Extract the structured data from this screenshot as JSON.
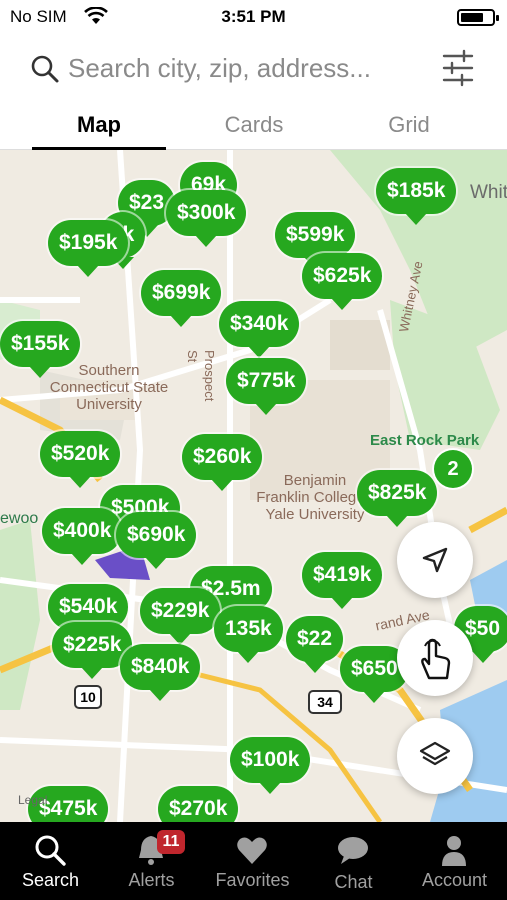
{
  "status_bar": {
    "carrier": "No SIM",
    "time": "3:51 PM"
  },
  "search": {
    "placeholder": "Search city, zip, address..."
  },
  "tabs": [
    {
      "label": "Map",
      "active": true
    },
    {
      "label": "Cards",
      "active": false
    },
    {
      "label": "Grid",
      "active": false
    }
  ],
  "map": {
    "places": {
      "university": "Southern Connecticut State University",
      "college": "Benjamin Franklin College - Yale University",
      "park": "East Rock Park",
      "street_whitney": "Whitney Ave",
      "street_prospect": "Prospect St",
      "street_orand": "rand Ave",
      "whitneyville": "Whitne",
      "westwood": "ewoo",
      "legal": "Legal",
      "route_34": "34",
      "route_10": "10"
    },
    "cluster_count": "2",
    "listings": [
      {
        "price": "$23",
        "color": "#26a81f"
      },
      {
        "price": "69k",
        "color": "#26a81f"
      },
      {
        "price": "0k",
        "color": "#26a81f"
      },
      {
        "price": "$300k",
        "color": "#26a81f"
      },
      {
        "price": "$195k",
        "color": "#26a81f"
      },
      {
        "price": "$599k",
        "color": "#26a81f"
      },
      {
        "price": "$185k",
        "color": "#26a81f"
      },
      {
        "price": "$625k",
        "color": "#26a81f"
      },
      {
        "price": "$699k",
        "color": "#26a81f"
      },
      {
        "price": "$340k",
        "color": "#26a81f"
      },
      {
        "price": "$155k",
        "color": "#26a81f"
      },
      {
        "price": "$775k",
        "color": "#26a81f"
      },
      {
        "price": "$520k",
        "color": "#26a81f"
      },
      {
        "price": "$260k",
        "color": "#26a81f"
      },
      {
        "price": "$825k",
        "color": "#26a81f"
      },
      {
        "price": "$500k",
        "color": "#26a81f"
      },
      {
        "price": "$400k",
        "color": "#26a81f"
      },
      {
        "price": "$690k",
        "color": "#26a81f"
      },
      {
        "price": "$419k",
        "color": "#26a81f"
      },
      {
        "price": "$2.5m",
        "color": "#26a81f"
      },
      {
        "price": "$540k",
        "color": "#26a81f"
      },
      {
        "price": "$229k",
        "color": "#26a81f"
      },
      {
        "price": "135k",
        "color": "#26a81f"
      },
      {
        "price": "$22",
        "color": "#26a81f"
      },
      {
        "price": "$50",
        "color": "#26a81f"
      },
      {
        "price": "$225k",
        "color": "#26a81f"
      },
      {
        "price": "$840k",
        "color": "#26a81f"
      },
      {
        "price": "$650",
        "color": "#26a81f"
      },
      {
        "price": "$100k",
        "color": "#26a81f"
      },
      {
        "price": "$475k",
        "color": "#26a81f"
      },
      {
        "price": "$270k",
        "color": "#26a81f"
      }
    ]
  },
  "tab_bar": {
    "items": [
      {
        "label": "Search",
        "active": true
      },
      {
        "label": "Alerts",
        "active": false,
        "badge": "11"
      },
      {
        "label": "Favorites",
        "active": false
      },
      {
        "label": "Chat",
        "active": false
      },
      {
        "label": "Account",
        "active": false
      }
    ]
  },
  "colors": {
    "pin": "#26a81f",
    "badge": "#c0262d",
    "tabbar": "#000000"
  }
}
